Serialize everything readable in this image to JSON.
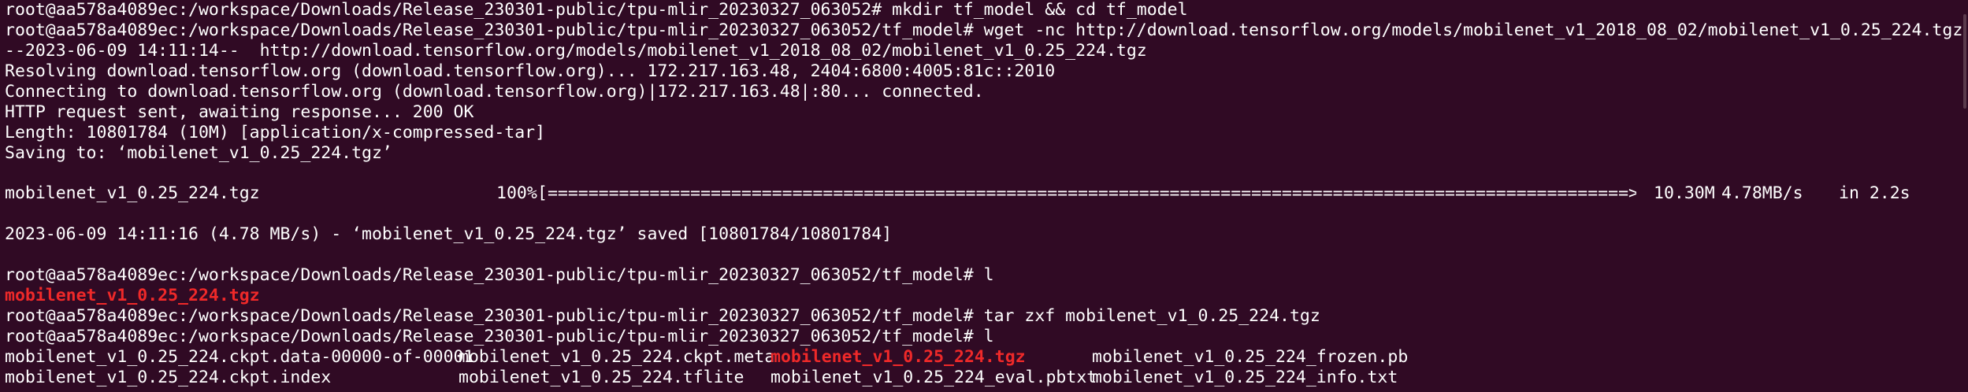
{
  "terminal": {
    "lines": [
      "root@aa578a4089ec:/workspace/Downloads/Release_230301-public/tpu-mlir_20230327_063052# mkdir tf_model && cd tf_model",
      "root@aa578a4089ec:/workspace/Downloads/Release_230301-public/tpu-mlir_20230327_063052/tf_model# wget -nc http://download.tensorflow.org/models/mobilenet_v1_2018_08_02/mobilenet_v1_0.25_224.tgz",
      "--2023-06-09 14:11:14--  http://download.tensorflow.org/models/mobilenet_v1_2018_08_02/mobilenet_v1_0.25_224.tgz",
      "Resolving download.tensorflow.org (download.tensorflow.org)... 172.217.163.48, 2404:6800:4005:81c::2010",
      "Connecting to download.tensorflow.org (download.tensorflow.org)|172.217.163.48|:80... connected.",
      "HTTP request sent, awaiting response... 200 OK",
      "Length: 10801784 (10M) [application/x-compressed-tar]",
      "Saving to: ‘mobilenet_v1_0.25_224.tgz’",
      "2023-06-09 14:11:16 (4.78 MB/s) - ‘mobilenet_v1_0.25_224.tgz’ saved [10801784/10801784]",
      "root@aa578a4089ec:/workspace/Downloads/Release_230301-public/tpu-mlir_20230327_063052/tf_model# l",
      "mobilenet_v1_0.25_224.tgz",
      "root@aa578a4089ec:/workspace/Downloads/Release_230301-public/tpu-mlir_20230327_063052/tf_model# tar zxf mobilenet_v1_0.25_224.tgz",
      "root@aa578a4089ec:/workspace/Downloads/Release_230301-public/tpu-mlir_20230327_063052/tf_model# l"
    ],
    "progress": {
      "filename": "mobilenet_v1_0.25_224.tgz",
      "percent_text": "100%",
      "bar": "[==========================================================================================================>]",
      "size": "10.30M",
      "speed": "4.78MB/s",
      "eta": "in 2.2s",
      "value": 1.0
    },
    "listing": {
      "col1": [
        "mobilenet_v1_0.25_224.ckpt.data-00000-of-00001",
        "mobilenet_v1_0.25_224.ckpt.index"
      ],
      "col2": [
        "mobilenet_v1_0.25_224.ckpt.meta",
        "mobilenet_v1_0.25_224.tflite"
      ],
      "col3": [
        "mobilenet_v1_0.25_224.tgz",
        "mobilenet_v1_0.25_224_eval.pbtxt"
      ],
      "col4": [
        "mobilenet_v1_0.25_224_frozen.pb",
        "mobilenet_v1_0.25_224_info.txt"
      ]
    },
    "colors": {
      "background": "#300a24",
      "text": "#ffffff",
      "archive": "#ef2929"
    }
  }
}
